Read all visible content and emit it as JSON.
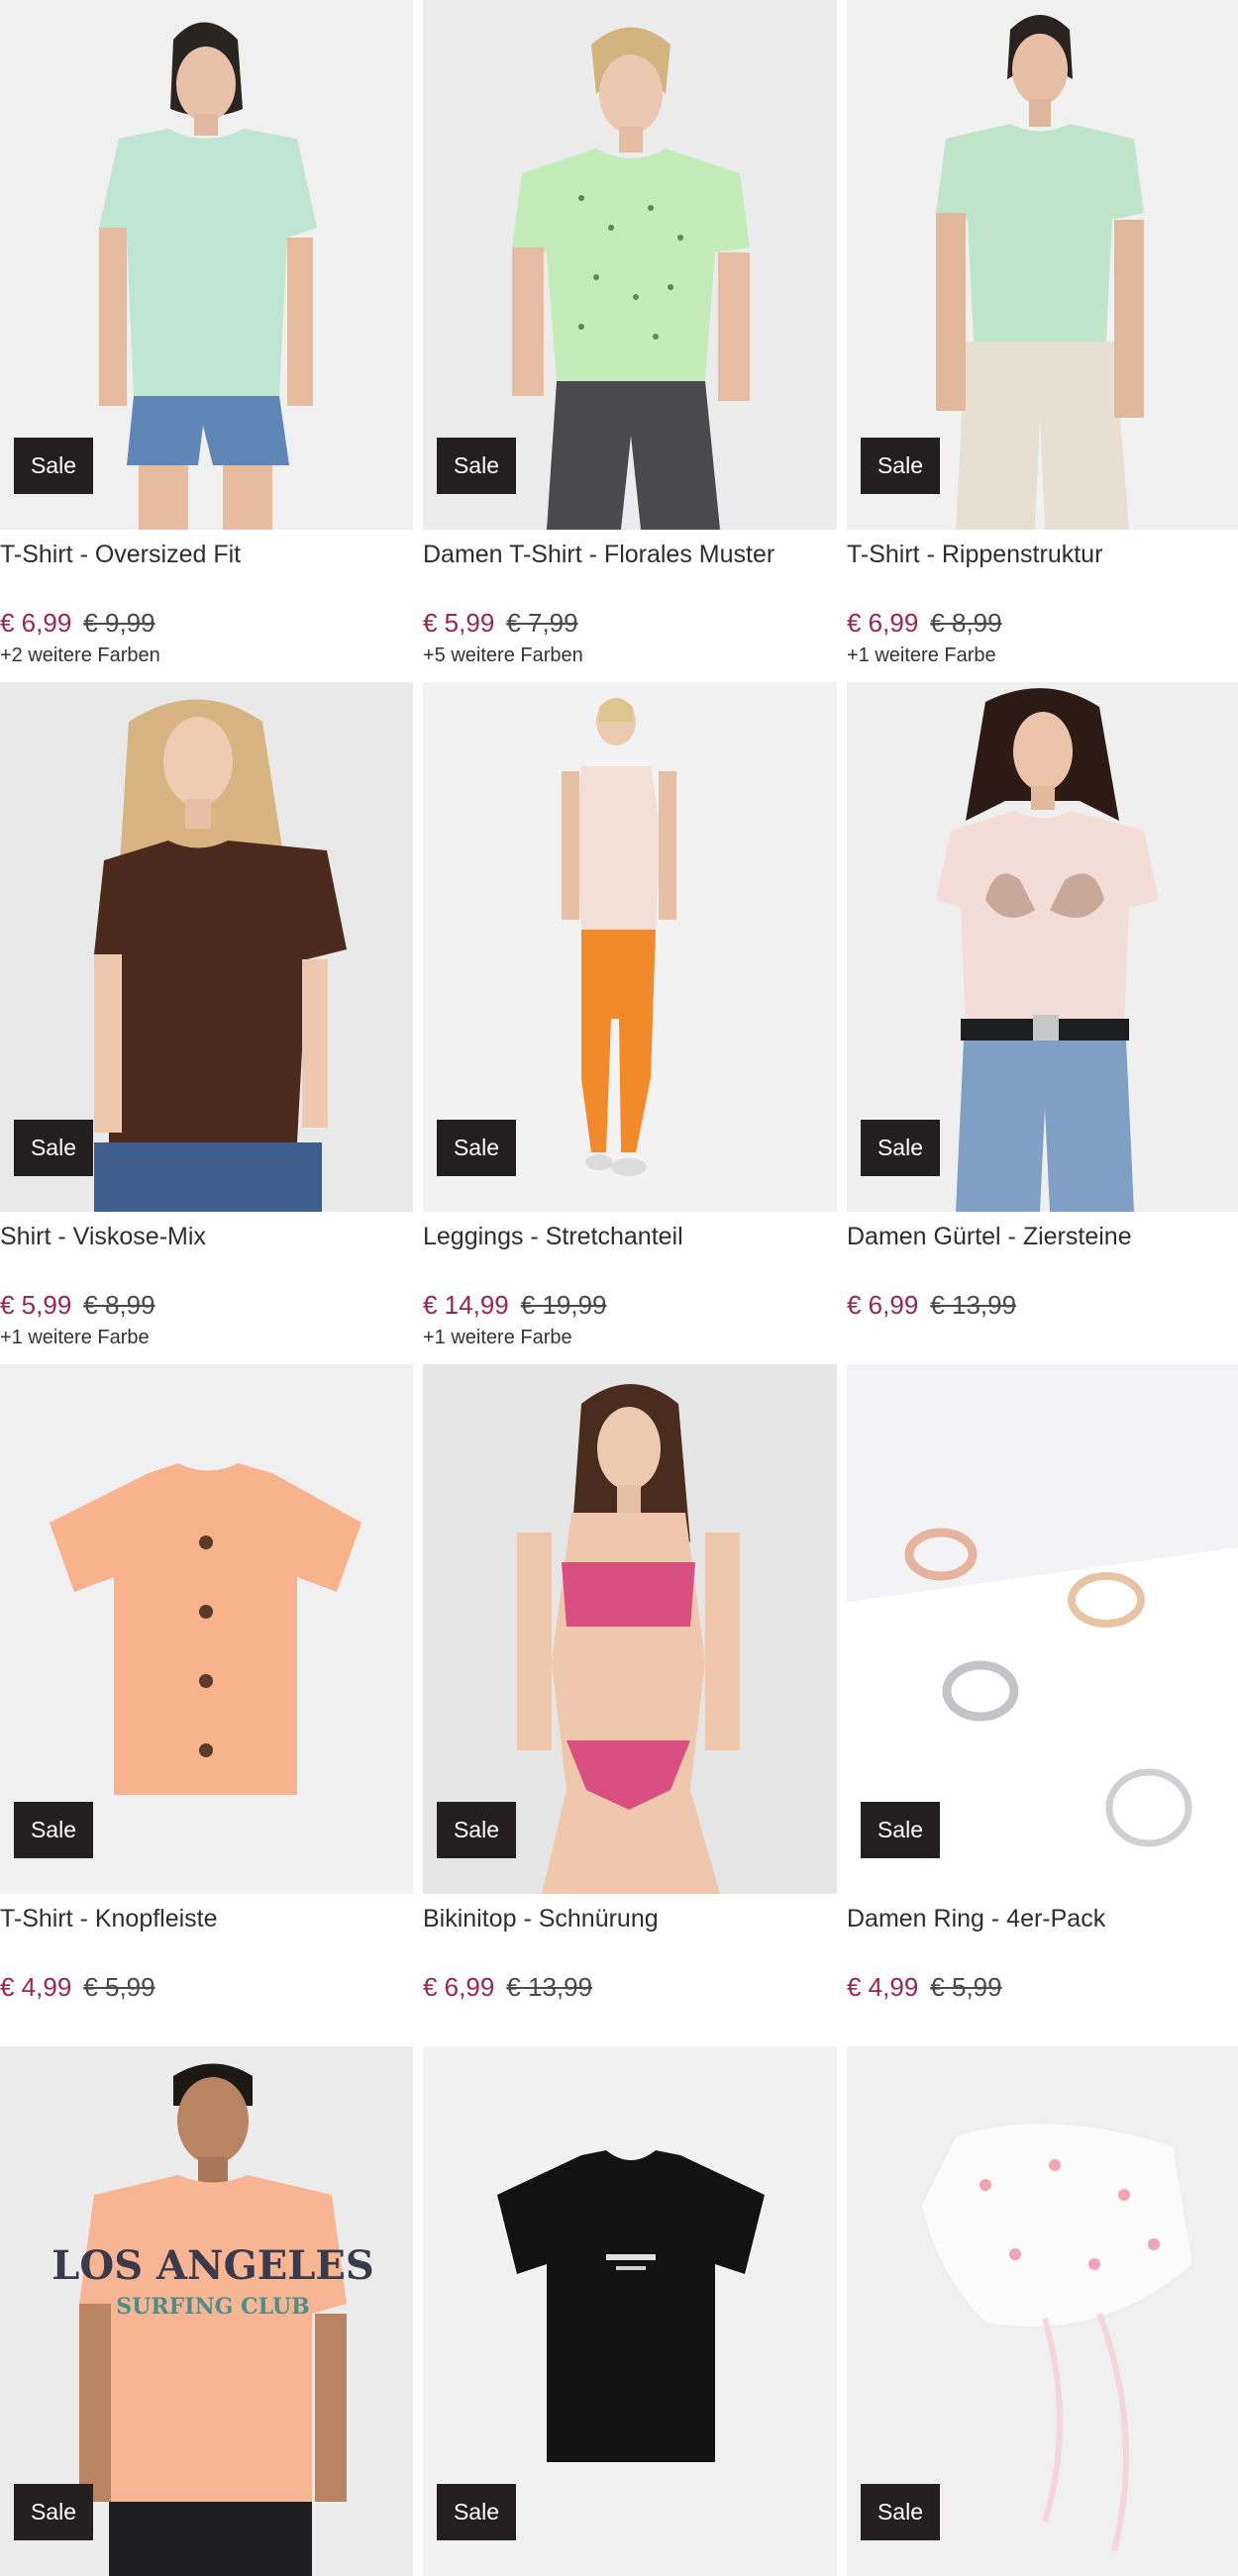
{
  "colors": {
    "sale_badge_bg": "#231f20",
    "price_now": "#9d2450",
    "image_bg": "#efefef"
  },
  "products": [
    {
      "title": "T-Shirt - Oversized Fit",
      "price_now": "€ 6,99",
      "price_old": "€ 9,99",
      "badge": "Sale",
      "colors": "+2 weitere Farben"
    },
    {
      "title": "Damen T-Shirt - Florales Muster",
      "price_now": "€ 5,99",
      "price_old": "€ 7,99",
      "badge": "Sale",
      "colors": "+5 weitere Farben"
    },
    {
      "title": "T-Shirt - Rippenstruktur",
      "price_now": "€ 6,99",
      "price_old": "€ 8,99",
      "badge": "Sale",
      "colors": "+1 weitere Farbe"
    },
    {
      "title": "Shirt - Viskose-Mix",
      "price_now": "€ 5,99",
      "price_old": "€ 8,99",
      "badge": "Sale",
      "colors": "+1 weitere Farbe"
    },
    {
      "title": "Leggings - Stretchanteil",
      "price_now": "€ 14,99",
      "price_old": "€ 19,99",
      "badge": "Sale",
      "colors": "+1 weitere Farbe"
    },
    {
      "title": "Damen Gürtel - Ziersteine",
      "price_now": "€ 6,99",
      "price_old": "€ 13,99",
      "badge": "Sale",
      "colors": ""
    },
    {
      "title": "T-Shirt - Knopfleiste",
      "price_now": "€ 4,99",
      "price_old": "€ 5,99",
      "badge": "Sale",
      "colors": ""
    },
    {
      "title": "Bikinitop - Schnürung",
      "price_now": "€ 6,99",
      "price_old": "€ 13,99",
      "badge": "Sale",
      "colors": ""
    },
    {
      "title": "Damen Ring - 4er-Pack",
      "price_now": "€ 4,99",
      "price_old": "€ 5,99",
      "badge": "Sale",
      "colors": ""
    },
    {
      "title": "",
      "price_now": "",
      "price_old": "",
      "badge": "Sale",
      "colors": "",
      "print_text": "LOS ANGELES",
      "print_subtext": "SURFING CLUB"
    },
    {
      "title": "",
      "price_now": "",
      "price_old": "",
      "badge": "Sale",
      "colors": ""
    },
    {
      "title": "",
      "price_now": "",
      "price_old": "",
      "badge": "Sale",
      "colors": ""
    }
  ]
}
